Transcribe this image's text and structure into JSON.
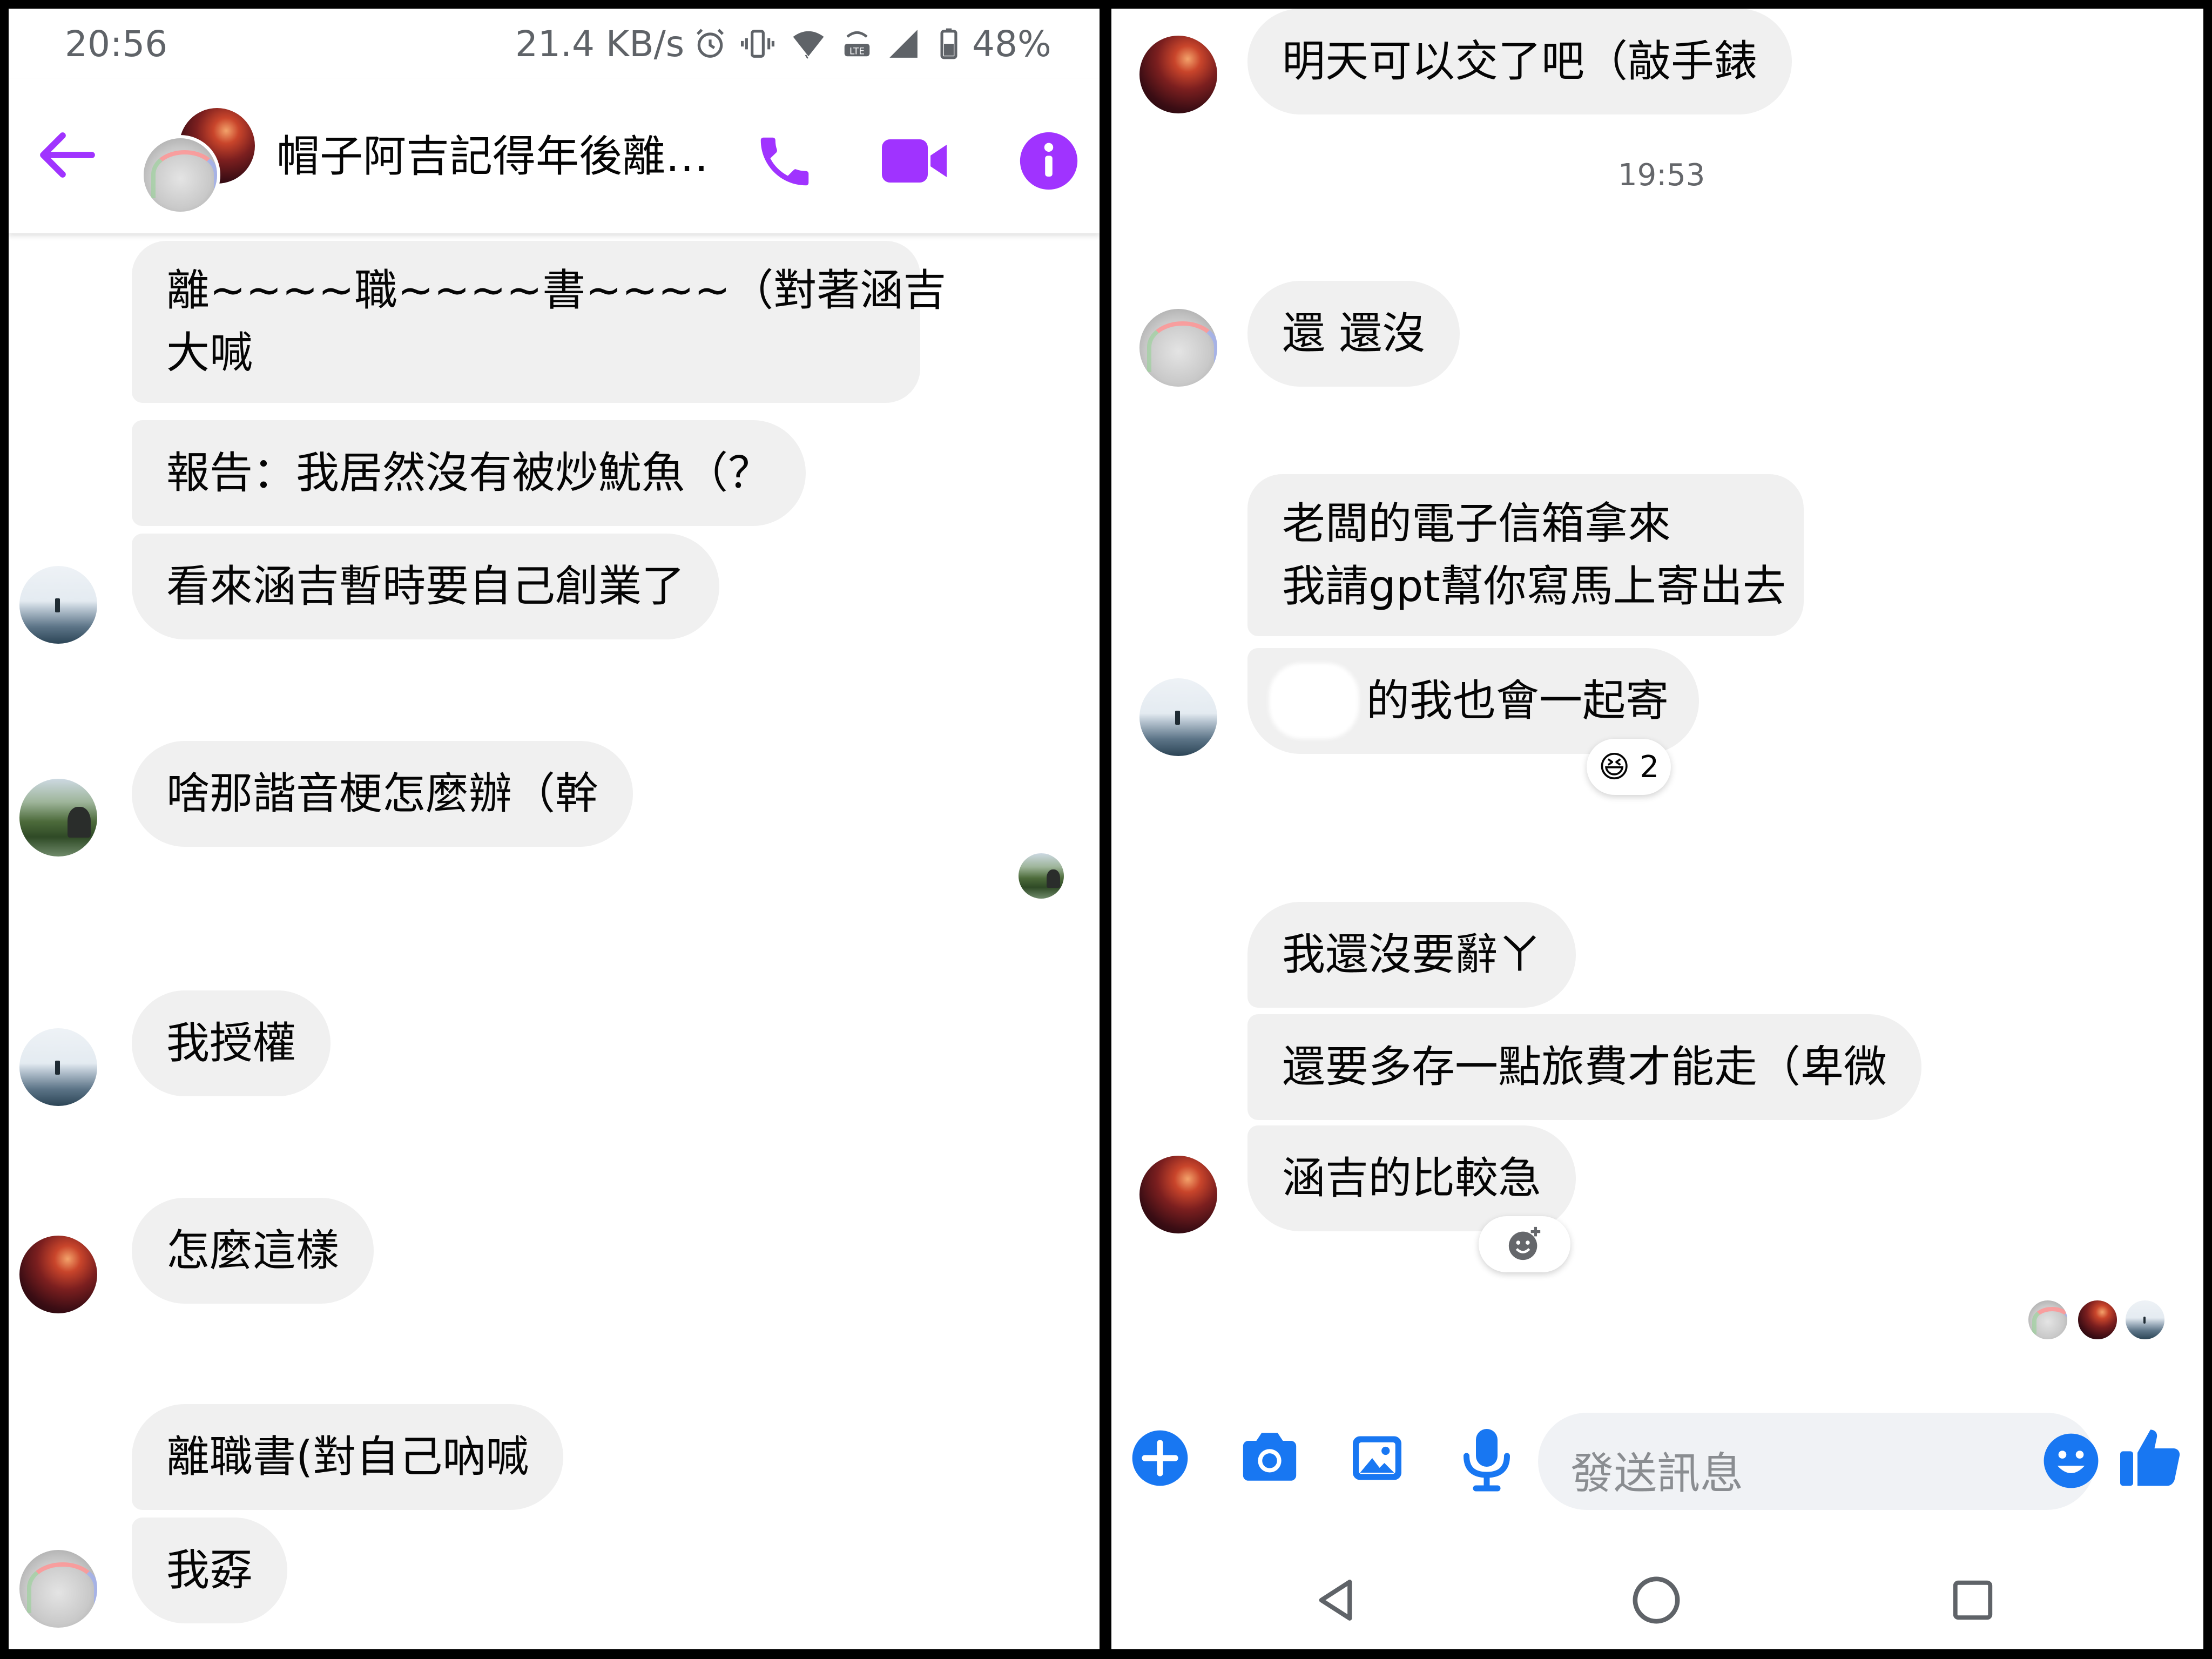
{
  "status_bar": {
    "time": "20:56",
    "network_speed": "21.4 KB/s",
    "battery": "48%",
    "icons": [
      "alarm-icon",
      "vibrate-icon",
      "wifi-icon",
      "volte-icon",
      "signal-icon",
      "battery-icon"
    ]
  },
  "header": {
    "title": "帽子阿吉記得年後離…",
    "icons": [
      "back-arrow-icon",
      "phone-icon",
      "video-call-icon",
      "info-icon"
    ],
    "accent_color": "#a033ff"
  },
  "left_messages": [
    {
      "text": "離~~~~職~~~~書~~~~（對著涵吉",
      "text2": "大喊"
    },
    {
      "text": "報告：我居然沒有被炒魷魚（？"
    },
    {
      "text": "看來涵吉暫時要自己創業了"
    },
    {
      "text": "啥那諧音梗怎麼辦（幹"
    },
    {
      "text": "我授權"
    },
    {
      "text": "怎麼這樣"
    },
    {
      "text": "離職書(對自己吶喊"
    },
    {
      "text": "我孬"
    }
  ],
  "right_messages": [
    {
      "text": "明天可以交了吧（敲手錶"
    },
    {
      "text": "還 還沒"
    },
    {
      "text": "老闆的電子信箱拿來",
      "text2": "我請gpt幫你寫馬上寄出去"
    },
    {
      "text": "的我也會一起寄"
    },
    {
      "text": "我還沒要辭ㄚ"
    },
    {
      "text": "還要多存一點旅費才能走（卑微"
    },
    {
      "text": "涵吉的比較急"
    }
  ],
  "timestamp": "19:53",
  "reaction": {
    "emoji": "😆",
    "count": "2"
  },
  "composer": {
    "placeholder": "發送訊息",
    "icons": [
      "add-icon",
      "camera-icon",
      "gallery-icon",
      "microphone-icon",
      "emoji-icon",
      "thumbs-up-icon"
    ],
    "accent_color": "#1877f2"
  },
  "navbar": {
    "icons": [
      "back-triangle-icon",
      "home-circle-icon",
      "recents-square-icon"
    ]
  }
}
